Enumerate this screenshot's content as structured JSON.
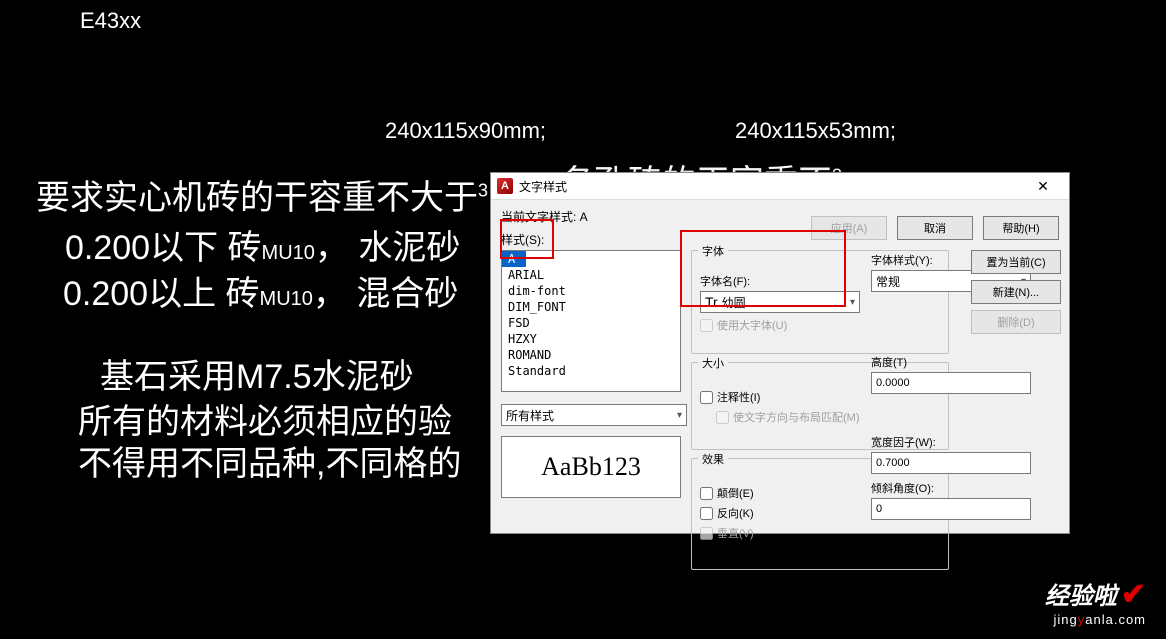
{
  "cad_bg": {
    "line1": "E43xx",
    "line2": "240x115x90mm;",
    "line3": "240x115x53mm;",
    "line4": "要求实心机砖的干容重不大于",
    "line5": "名孔砖的干容重不",
    "line6a": "0.200以下  砖",
    "line6b": "MU10",
    "line6c": "，  水泥砂",
    "line7a": "0.200以上  砖",
    "line7b": "MU10",
    "line7c": "，  混合砂",
    "line8": "基石采用M7.5水泥砂",
    "line9": "所有的材料必须相应的验",
    "line10": "不得用不同品种,不同格的"
  },
  "dlg": {
    "title": "文字样式",
    "current_label": "当前文字样式:  A",
    "styles_label": "样式(S):",
    "styles": [
      "A",
      "ARIAL",
      "dim-font",
      "DIM_FONT",
      "FSD",
      "HZXY",
      "ROMAND",
      "Standard"
    ],
    "filter": "所有样式",
    "preview": "AaBb123",
    "font_group": "字体",
    "font_name_label": "字体名(F):",
    "font_name_value": "幼圆",
    "font_style_label": "字体样式(Y):",
    "font_style_value": "常规",
    "use_big_font": "使用大字体(U)",
    "size_group": "大小",
    "annotative": "注释性(I)",
    "match_orient": "使文字方向与布局匹配(M)",
    "height_label": "高度(T)",
    "height_value": "0.0000",
    "effects_group": "效果",
    "upside_down": "颠倒(E)",
    "backwards": "反向(K)",
    "vertical": "垂直(V)",
    "width_label": "宽度因子(W):",
    "width_value": "0.7000",
    "oblique_label": "倾斜角度(O):",
    "oblique_value": "0",
    "btn_set_current": "置为当前(C)",
    "btn_new": "新建(N)...",
    "btn_delete": "删除(D)",
    "btn_apply": "应用(A)",
    "btn_cancel": "取消",
    "btn_help": "帮助(H)"
  },
  "watermark": {
    "big": "经验啦",
    "url_pre": "jing",
    "url_y": "y",
    "url_post": "anla.com"
  }
}
